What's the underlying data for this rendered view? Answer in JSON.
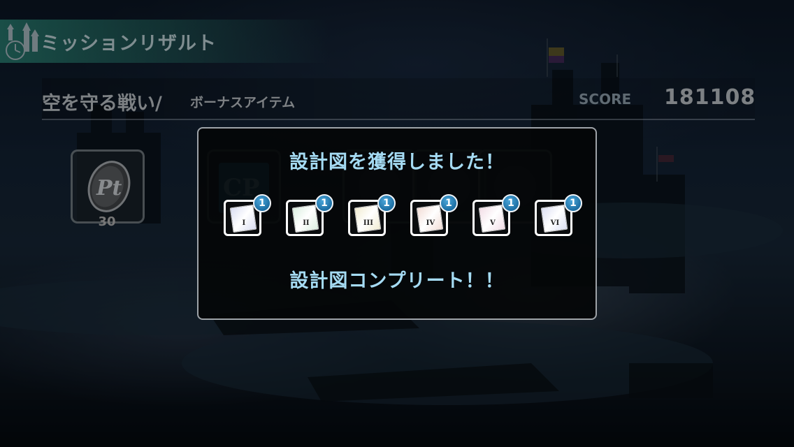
{
  "header": {
    "title": "ミッションリザルト"
  },
  "mission": {
    "name": "空を守る戦い/",
    "bonus_label": "ボーナスアイテム",
    "score_label": "SCORE",
    "score_value": "181108"
  },
  "bonus_items": [
    {
      "icon": "pt-coin-icon",
      "count": "30"
    },
    {
      "icon": "cp-icon"
    },
    {
      "icon": "item-icon"
    },
    {
      "icon": "item-icon"
    },
    {
      "icon": "item-icon"
    }
  ],
  "dialog": {
    "title": "設計図を獲得しました！",
    "complete_text": "設計図コンプリート！！",
    "blueprints": [
      {
        "numeral": "I",
        "count": "1",
        "color": "#d9ddf2"
      },
      {
        "numeral": "II",
        "count": "1",
        "color": "#dbefe0"
      },
      {
        "numeral": "III",
        "count": "1",
        "color": "#f1ecd2"
      },
      {
        "numeral": "IV",
        "count": "1",
        "color": "#f2ddd6"
      },
      {
        "numeral": "V",
        "count": "1",
        "color": "#f2dde6"
      },
      {
        "numeral": "VI",
        "count": "1",
        "color": "#dcdff2"
      }
    ]
  },
  "colors": {
    "dialog_text": "#a5dbf3",
    "badge": "#1c6ea3"
  }
}
